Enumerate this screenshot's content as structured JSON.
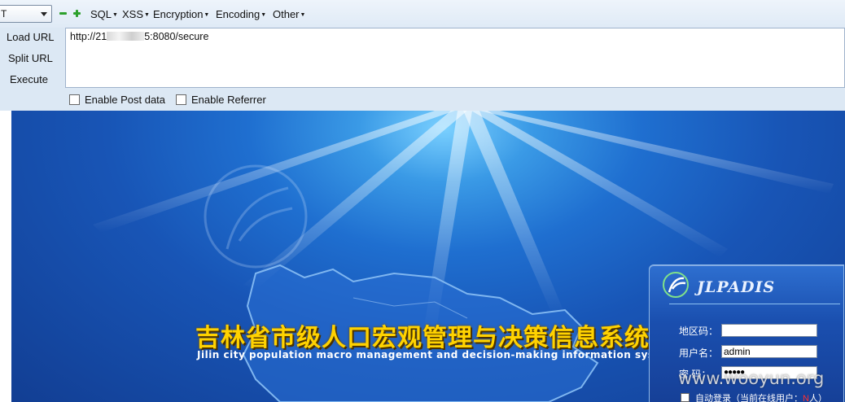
{
  "toolbar": {
    "method_value": "T",
    "menus": [
      "SQL",
      "XSS",
      "Encryption",
      "Encoding",
      "Other"
    ]
  },
  "actions": {
    "load_url": "Load URL",
    "split_url": "Split URL",
    "execute": "Execute"
  },
  "url": {
    "prefix": "http://21",
    "suffix": "5:8080/secure"
  },
  "options": {
    "post_data_label": "Enable Post data",
    "referrer_label": "Enable Referrer"
  },
  "banner": {
    "title_cn": "吉林省市级人口宏观管理与决策信息系统",
    "title_en": "Jilin city population macro management and decision-making information system"
  },
  "login": {
    "brand": "JLPADIS",
    "region_label": "地区码：",
    "region_value": "",
    "username_label": "用户名：",
    "username_value": "admin",
    "password_label": "密  码：",
    "password_value": "●●●●●",
    "remember_label": "自动登录（当前在线用户：",
    "online_count": "N",
    "remember_suffix": "人）"
  },
  "watermark": "www.wooyun.org",
  "colors": {
    "toolbar_bg": "#dce8f4",
    "banner_blue": "#1855b6",
    "title_yellow": "#ffd200",
    "icon_green": "#2ca02c"
  }
}
